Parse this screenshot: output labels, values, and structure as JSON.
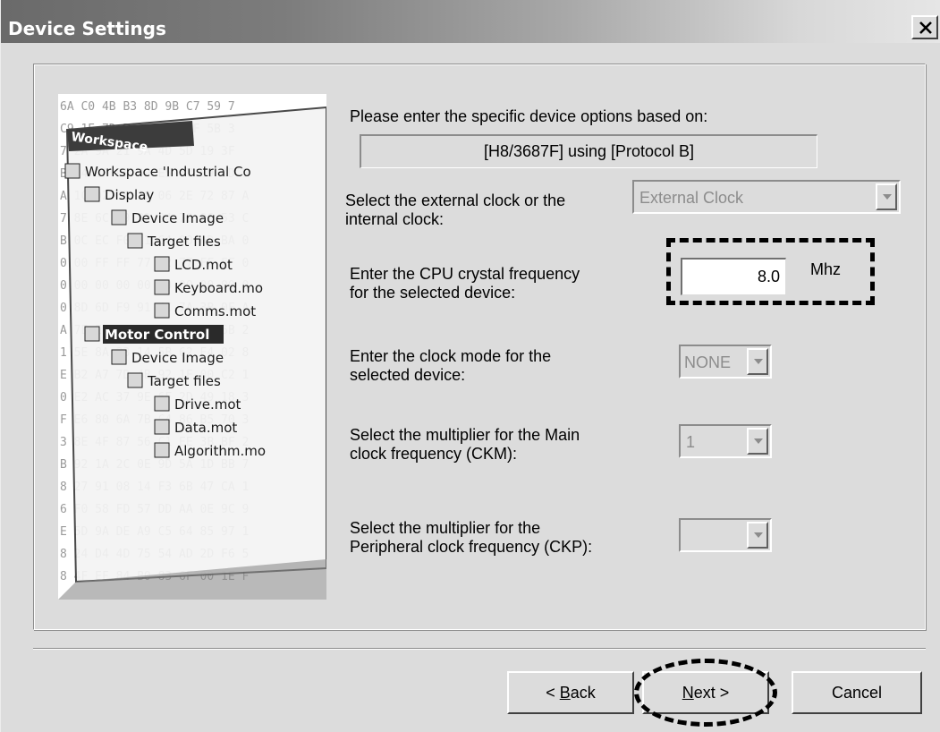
{
  "window": {
    "title": "Device Settings",
    "close_symbol": "X"
  },
  "illustration": {
    "panel_title": "Workspace",
    "tree": [
      "Workspace 'Industrial Co",
      "Display",
      "Device Image",
      "Target files",
      "LCD.mot",
      "Keyboard.mo",
      "Comms.mot",
      "Motor Control",
      "Device Image",
      "Target files",
      "Drive.mot",
      "Data.mot",
      "Algorithm.mo"
    ],
    "hex_rows": [
      "6A C0 4B B3 8D 9B C7 59 7",
      "C9 1E 7D D1 48 DA FF 5B 3",
      "7 2A 9A 21 9A 4D 5D 19 3F",
      "B A4 1F 9F 49 E5 67 09 DD 5",
      "A 1C D2 6B 18 06 2E 72 87 A",
      "7 8E 6C E9 B2 34 70 06 53 C",
      "B 0C EC F0 11 64 00 AD BA 0",
      "0 00 FF FF 77 E2 77 FF FF 0",
      "0 00 00 00 00 00 00 00 00 0",
      "0 8D 6D F9 91 4C 7A 3B 0F A",
      "A 7E E8 B1 1E C9 04 9D 6B 2",
      "1 5E 8A 33 14 5B 62 E4 02 8",
      "E B2 A7 7D 4B 92 1F 00 C2 1",
      "0 E2 AC 37 9E 6F 2D 49 18 3",
      "F E6 80 6A 7B C4 86 B5 70 3",
      "3 8E 4F 87 56 C1 EE 3B BF 2",
      "B 92 1A 2C 0E 9D 5A 1D BB 7",
      "8 27 91 08 14 F3 6B 47 CA 1",
      "6 F0 58 FD 57 DD AA 0E 9C 9",
      "E 5D 9A DE A9 C5 64 85 97 1",
      "8 24 D4 4D 75 54 AD 2D F6 5",
      "8 4F EF 84 B0 83 6F 00 1E F"
    ]
  },
  "form": {
    "intro_label": "Please enter the specific device options based on:",
    "device_text": "[H8/3687F]  using  [Protocol B]",
    "clock_select_label": "Select the external clock or the\ninternal clock:",
    "clock_select_value": "External Clock",
    "crystal_label": "Enter the CPU crystal frequency\nfor the selected device:",
    "crystal_value": "8.0",
    "crystal_unit": "Mhz",
    "clock_mode_label": "Enter the clock mode for the\nselected device:",
    "clock_mode_value": "NONE",
    "ckm_label": "Select the multiplier for the Main\nclock frequency (CKM):",
    "ckm_value": "1",
    "ckp_label": "Select the multiplier for the\nPeripheral clock frequency (CKP):",
    "ckp_value": ""
  },
  "buttons": {
    "back_prefix": "< ",
    "back_mnemonic": "B",
    "back_rest": "ack",
    "next_mnemonic": "N",
    "next_rest": "ext >",
    "cancel": "Cancel"
  },
  "colors": {
    "dialog_bg": "#dcdcdc",
    "title_gradient_start": "#6a6a6a",
    "disabled_text": "#8c8c8c"
  }
}
